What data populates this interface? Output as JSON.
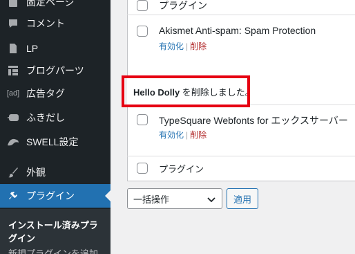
{
  "sidebar": {
    "items": [
      {
        "label": "固定ページ",
        "icon": "page-icon"
      },
      {
        "label": "コメント",
        "icon": "comment-icon"
      },
      {
        "label": "LP",
        "icon": "document-icon"
      },
      {
        "label": "ブログパーツ",
        "icon": "grid-icon"
      },
      {
        "label": "広告タグ",
        "icon": "ad-icon",
        "icon_text": "[ad]"
      },
      {
        "label": "ふきだし",
        "icon": "speech-bubble-icon"
      },
      {
        "label": "SWELL設定",
        "icon": "swell-icon"
      },
      {
        "label": "外観",
        "icon": "brush-icon"
      },
      {
        "label": "プラグイン",
        "icon": "plugin-icon"
      }
    ],
    "submenu": {
      "current": "インストール済みプラグイン",
      "next": "新規プラグインを追加"
    }
  },
  "plugins_table": {
    "header_label": "プラグイン",
    "footer_label": "プラグイン",
    "rows": [
      {
        "name": "Akismet Anti-spam: Spam Protection",
        "activate": "有効化",
        "delete": "削除"
      },
      {
        "name": "TypeSquare Webfonts for エックスサーバー",
        "activate": "有効化",
        "delete": "削除"
      }
    ],
    "deleted_notice": {
      "plugin": "Hello Dolly",
      "message": " を削除しました。"
    },
    "action_separator": "|"
  },
  "bulk_actions": {
    "selected": "一括操作",
    "apply": "適用"
  },
  "colors": {
    "sidebar_bg": "#1d2327",
    "active_bg": "#2271b1",
    "delete_link": "#b32d2e",
    "highlight": "#e60012"
  }
}
